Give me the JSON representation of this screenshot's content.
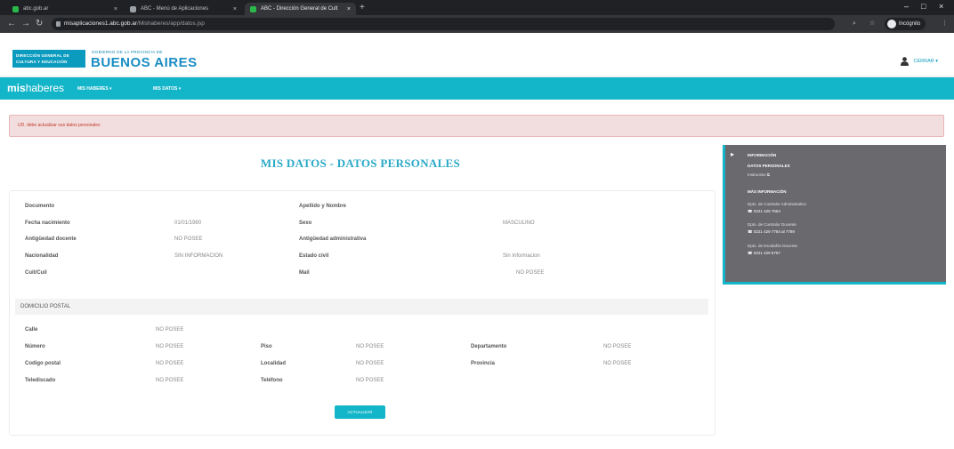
{
  "browser": {
    "tabs": [
      {
        "title": "abc.gob.ar",
        "active": false
      },
      {
        "title": "ABC - Menú de Aplicaciones",
        "active": false
      },
      {
        "title": "ABC - Dirección General de Cult",
        "active": true
      }
    ],
    "url_host": "misaplicaciones1.abc.gob.ar",
    "url_path": "/Mishaberes/app/datos.jsp",
    "profile_label": "Incógnito",
    "new_tab_symbol": "+",
    "window_controls": [
      "–",
      "□",
      "×"
    ]
  },
  "header": {
    "badge_line1": "DIRECCIÓN GENERAL DE",
    "badge_line2": "CULTURA Y EDUCACIÓN",
    "small_text": "GOBIERNO DE LA PROVINCIA DE",
    "big_text": "BUENOS AIRES",
    "user_label": "CERRAR ▾"
  },
  "navbar": {
    "brand_bold": "mis",
    "brand_rest": "haberes",
    "item1": "MIS HABERES ▾",
    "item2": "MIS DATOS ▾"
  },
  "alert": {
    "text": "UD. debe actualizar sus datos personales"
  },
  "page": {
    "title": "MIS DATOS - DATOS PERSONALES"
  },
  "personal": {
    "documento_label": "Documento",
    "apellido_label": "Apellido y Nombre",
    "fecha_label": "Fecha nacimiento",
    "fecha_value": "01/01/1980",
    "sexo_label": "Sexo",
    "sexo_value": "MASCULINO",
    "antig_doc_label": "Antigüedad docente",
    "antig_doc_value": "NO POSEE",
    "antig_adm_label": "Antigüedad administrativa",
    "nacionalidad_label": "Nacionalidad",
    "nacionalidad_value": "SIN INFORMACION",
    "estado_civil_label": "Estado civil",
    "estado_civil_value": "Sin Informacion",
    "cuit_label": "Cuit/Cuil",
    "mail_label": "Mail",
    "mail_value": "NO POSEE"
  },
  "domicilio": {
    "section_title": "DOMICILIO POSTAL",
    "calle_label": "Calle",
    "calle_value": "NO POSEE",
    "numero_label": "Número",
    "numero_value": "NO POSEE",
    "piso_label": "Piso",
    "piso_value": "NO POSEE",
    "depto_label": "Departamento",
    "depto_value": "NO POSEE",
    "cp_label": "Codigo postal",
    "cp_value": "NO POSEE",
    "localidad_label": "Localidad",
    "localidad_value": "NO POSEE",
    "provincia_label": "Provincia",
    "provincia_value": "NO POSEE",
    "telediscado_label": "Telediscado",
    "telediscado_value": "NO POSEE",
    "telefono_label": "Teléfono",
    "telefono_value": "NO POSEE",
    "button_label": "ACTUALIZAR"
  },
  "info": {
    "heading": "INFORMACIÓN",
    "sub1": "DATOS PERSONALES",
    "sub1_link": "Instructivo",
    "sub2": "MÁS INFORMACIÓN",
    "c1_name": "Dpto. de Contralor Administrativo",
    "c1_phone": "0221 429 7654",
    "c2_name": "Dpto. de Contralor Docente",
    "c2_phone": "0221 429 7784 al 7789",
    "c3_name": "Dpto. de Escalafón Docente",
    "c3_phone": "0221 429 5757"
  },
  "colors": {
    "teal": "#13b5c8",
    "title_blue": "#2aa9c7",
    "alert_bg": "#f2dede",
    "panel_gray": "#69696e"
  }
}
